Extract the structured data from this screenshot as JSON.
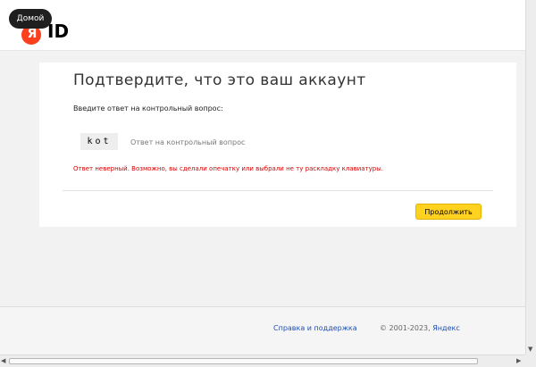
{
  "header": {
    "logo_letter": "Я",
    "logo_id": "ID",
    "home_tooltip": "Домой"
  },
  "form": {
    "title": "Подтвердите, что это ваш аккаунт",
    "question_prompt": "Введите ответ на контрольный вопрос:",
    "answer_value": "kot",
    "answer_label": "Ответ на контрольный вопрос",
    "error": "Ответ неверный. Возможно, вы сделали опечатку или выбрали не ту раскладку клавиатуры.",
    "continue_label": "Продолжить"
  },
  "footer": {
    "help_link": "Справка и поддержка",
    "copyright": "© 2001-2023,",
    "brand": "Яндекс"
  },
  "colors": {
    "accent_button": "#ffd21f",
    "error_text": "#d40000",
    "link": "#1f4fb3",
    "logo": "#fc3f1d"
  }
}
